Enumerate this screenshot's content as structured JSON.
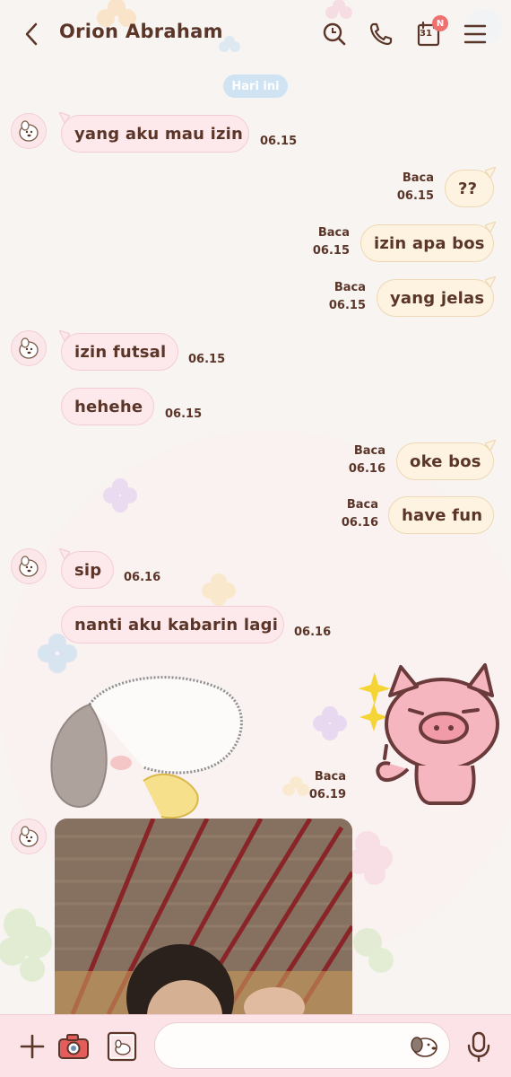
{
  "header": {
    "title": "Orion Abraham",
    "calendar_day": "31",
    "calendar_badge": "N"
  },
  "date_divider": "Hari ini",
  "messages": [
    {
      "dir": "in",
      "text": "yang aku mau izin",
      "time": "06.15"
    },
    {
      "dir": "out",
      "text": "??",
      "status": "Baca",
      "time": "06.15"
    },
    {
      "dir": "out",
      "text": "izin apa bos",
      "status": "Baca",
      "time": "06.15"
    },
    {
      "dir": "out",
      "text": "yang jelas",
      "status": "Baca",
      "time": "06.15"
    },
    {
      "dir": "in",
      "text": "izin futsal",
      "time": "06.15"
    },
    {
      "dir": "in",
      "text": "hehehe",
      "time": "06.15"
    },
    {
      "dir": "out",
      "text": "oke bos",
      "status": "Baca",
      "time": "06.16"
    },
    {
      "dir": "out",
      "text": "have fun",
      "status": "Baca",
      "time": "06.16"
    },
    {
      "dir": "in",
      "text": "sip",
      "time": "06.16"
    },
    {
      "dir": "in",
      "text": "nanti aku kabarin lagi",
      "time": "06.16"
    },
    {
      "dir": "out",
      "type": "sticker",
      "status": "Baca",
      "time": "06.19"
    },
    {
      "dir": "in",
      "type": "photo"
    }
  ],
  "composer": {
    "placeholder": ""
  },
  "colors": {
    "incoming_bubble": "#fde9ec",
    "outgoing_bubble": "#fdf3e0",
    "text": "#5a3528",
    "date_chip": "#cfe3f3",
    "badge": "#f07070",
    "bottom_bar": "#fbe3e8"
  },
  "icons": {
    "header": [
      "back-icon",
      "search-icon",
      "phone-icon",
      "calendar-icon",
      "menu-icon"
    ],
    "bottom": [
      "plus-icon",
      "camera-icon",
      "gallery-icon",
      "emoji-icon",
      "microphone-icon"
    ]
  }
}
